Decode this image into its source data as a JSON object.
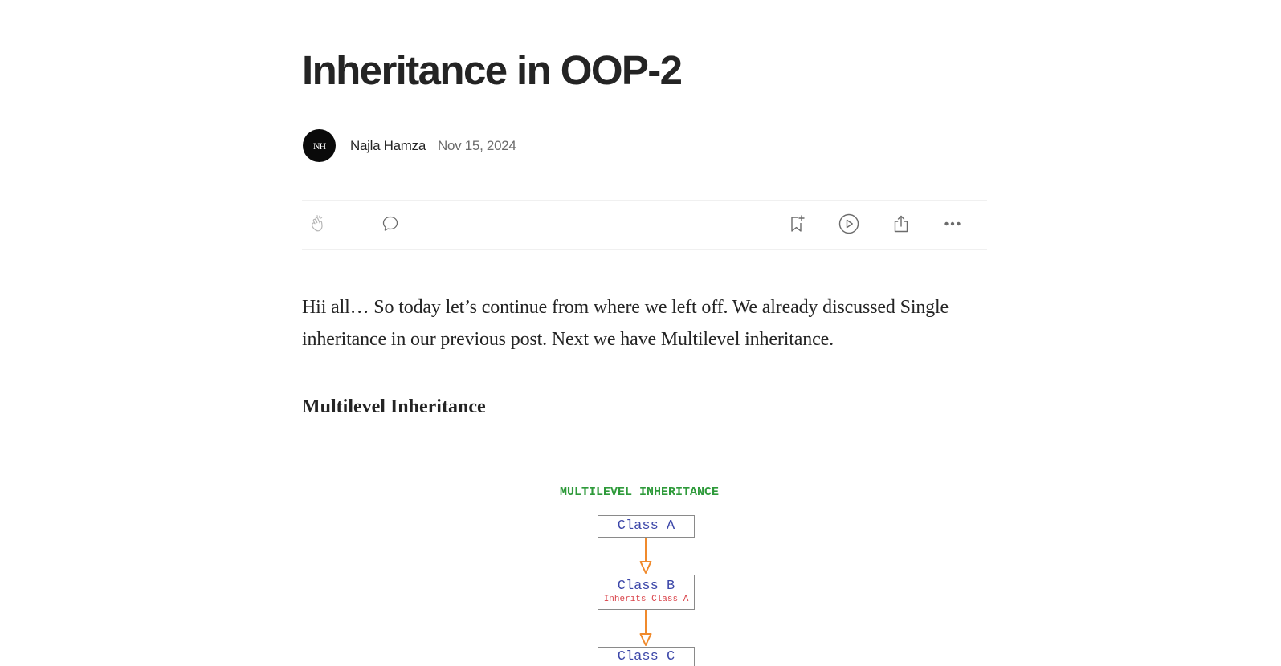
{
  "article": {
    "title": "Inheritance in OOP-2",
    "author": {
      "name": "Najla Hamza",
      "avatar_initials": "NH"
    },
    "date": "Nov 15, 2024",
    "body_paragraph": "Hii all… So today let’s continue from where we left off. We already discussed Single inheritance in our previous post. Next we have Multilevel inheritance.",
    "subheading": "Multilevel Inheritance"
  },
  "action_bar": {
    "left": [
      {
        "icon": "clap-icon"
      },
      {
        "icon": "comment-icon"
      }
    ],
    "right": [
      {
        "icon": "bookmark-add-icon"
      },
      {
        "icon": "play-icon"
      },
      {
        "icon": "share-icon"
      },
      {
        "icon": "more-icon"
      }
    ]
  },
  "diagram": {
    "title": "MULTILEVEL INHERITANCE",
    "classes": [
      {
        "name": "Class A",
        "note": ""
      },
      {
        "name": "Class B",
        "note": "Inherits Class A"
      },
      {
        "name": "Class C",
        "note": ""
      }
    ],
    "colors": {
      "title": "#2e9a3a",
      "class_name": "#3b46a8",
      "note": "#d9434a",
      "arrow": "#f08a2c",
      "box_border": "#8a8a8a"
    }
  }
}
